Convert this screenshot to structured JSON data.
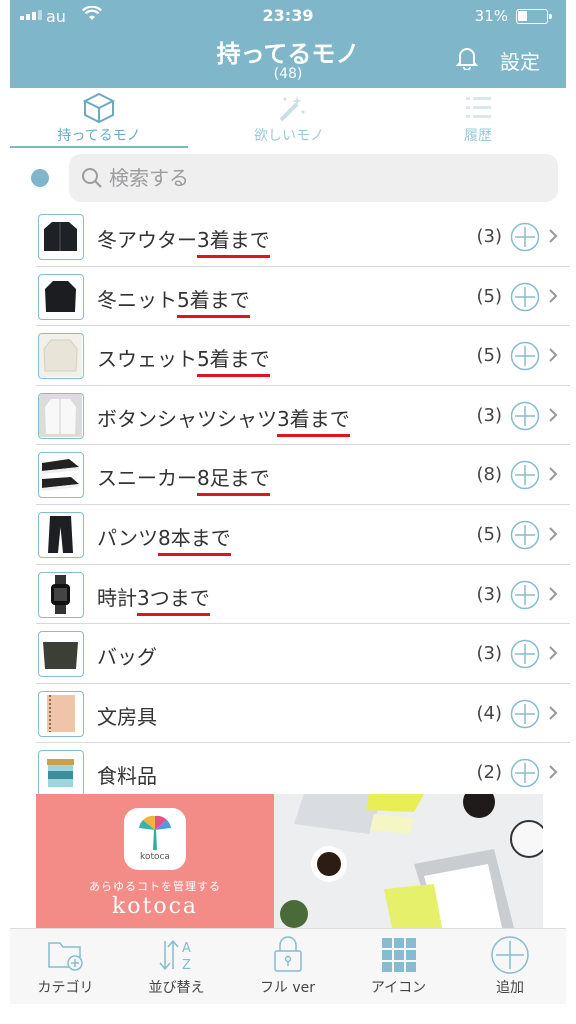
{
  "status_bar": {
    "carrier": "au",
    "time": "23:39",
    "battery": "31%",
    "battery_level": 0.31
  },
  "header": {
    "title": "持ってるモノ",
    "count": "(48)",
    "settings_label": "設定"
  },
  "tabs": [
    {
      "label": "持ってるモノ",
      "icon": "box-icon",
      "active": true
    },
    {
      "label": "欲しいモノ",
      "icon": "magic-wand-icon",
      "active": false
    },
    {
      "label": "履歴",
      "icon": "list-icon",
      "active": false
    }
  ],
  "search": {
    "placeholder": "検索する"
  },
  "items": [
    {
      "name": "冬アウター",
      "limit": "3着まで",
      "count": "(3)",
      "thumb": "jacket"
    },
    {
      "name": "冬ニット",
      "limit": "5着まで",
      "count": "(5)",
      "thumb": "knit"
    },
    {
      "name": "スウェット",
      "limit": "5着まで",
      "count": "(5)",
      "thumb": "sweat"
    },
    {
      "name": "ボタンシャツシャツ",
      "limit": "3着まで",
      "count": "(3)",
      "thumb": "shirt"
    },
    {
      "name": "スニーカー",
      "limit": "8足まで",
      "count": "(8)",
      "thumb": "sneaker"
    },
    {
      "name": "パンツ",
      "limit": "8本まで",
      "count": "(5)",
      "thumb": "pants"
    },
    {
      "name": "時計",
      "limit": "3つまで",
      "count": "(3)",
      "thumb": "watch"
    },
    {
      "name": "バッグ",
      "limit": "",
      "count": "(3)",
      "thumb": "bag"
    },
    {
      "name": "文房具",
      "limit": "",
      "count": "(4)",
      "thumb": "notebook"
    },
    {
      "name": "食料品",
      "limit": "",
      "count": "(2)",
      "thumb": "jar"
    }
  ],
  "banner": {
    "app_label": "kotoca",
    "tagline": "あらゆるコトを管理する",
    "brand": "kotoca"
  },
  "bottom_bar": [
    {
      "label": "カテゴリ",
      "icon": "folder-add-icon"
    },
    {
      "label": "並び替え",
      "icon": "sort-az-icon"
    },
    {
      "label": "フル ver",
      "icon": "lock-icon"
    },
    {
      "label": "アイコン",
      "icon": "grid-icon"
    },
    {
      "label": "追加",
      "icon": "add-circle-icon"
    }
  ],
  "colors": {
    "primary": "#7fb6c9",
    "underline": "#e0141e",
    "banner": "#f38b87"
  }
}
